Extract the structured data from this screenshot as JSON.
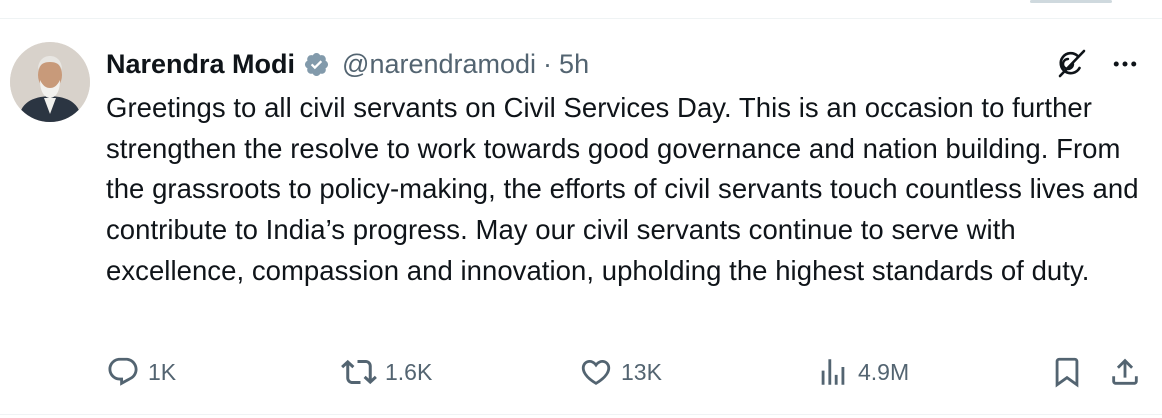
{
  "tweet": {
    "author_name": "Narendra Modi",
    "handle": "@narendramodi",
    "separator": "·",
    "time": "5h",
    "text": "Greetings to all civil servants on Civil Services Day. This is an occasion to further strengthen the resolve to work towards good governance and nation building. From the grassroots to policy-making, the efforts of civil servants touch countless lives and contribute to India’s progress. May our civil servants continue to serve with excellence, compassion and innovation, upholding the highest standards of duty.",
    "verified": true
  },
  "actions": {
    "replies": "1K",
    "reposts": "1.6K",
    "likes": "13K",
    "views": "4.9M"
  },
  "icons": {
    "header": [
      "verified-badge-icon",
      "grok-icon",
      "more-icon"
    ],
    "actions": [
      "reply-icon",
      "repost-icon",
      "like-icon",
      "views-icon",
      "bookmark-icon",
      "share-icon"
    ]
  },
  "colors": {
    "text": "#0f1419",
    "secondary": "#536471",
    "verified_badge": "#829aab",
    "divider": "#eff3f4"
  }
}
